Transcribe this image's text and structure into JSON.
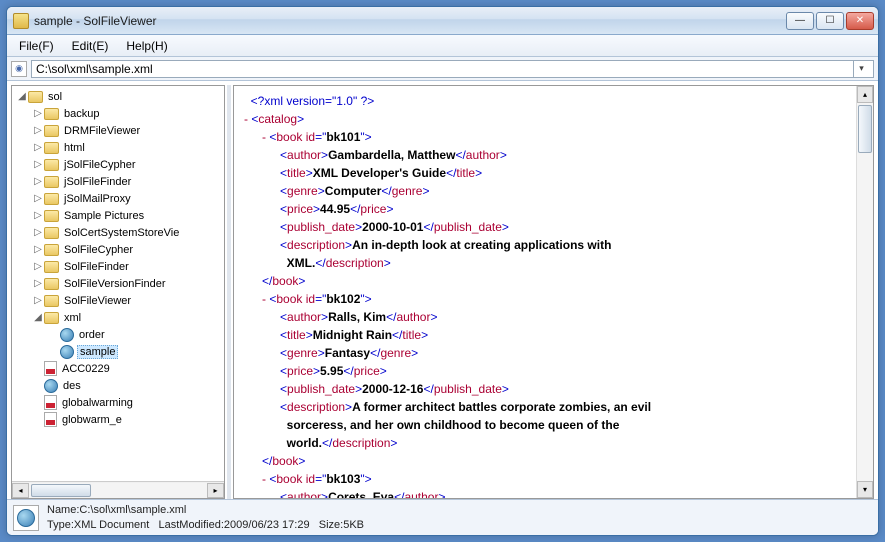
{
  "window": {
    "title": "sample - SolFileViewer"
  },
  "menu": {
    "file": "File(F)",
    "edit": "Edit(E)",
    "help": "Help(H)"
  },
  "address": {
    "path": "C:\\sol\\xml\\sample.xml"
  },
  "tree": {
    "root": "sol",
    "folders": [
      "backup",
      "DRMFileViewer",
      "html",
      "jSolFileCypher",
      "jSolFileFinder",
      "jSolMailProxy",
      "Sample Pictures",
      "SolCertSystemStoreVie",
      "SolFileCypher",
      "SolFileFinder",
      "SolFileVersionFinder",
      "SolFileViewer"
    ],
    "xml_folder": "xml",
    "xml_children": [
      {
        "name": "order",
        "type": "earth"
      },
      {
        "name": "sample",
        "type": "earth",
        "selected": true
      }
    ],
    "other_children": [
      {
        "name": "ACC0229",
        "type": "pdf"
      },
      {
        "name": "des",
        "type": "earth"
      },
      {
        "name": "globalwarming",
        "type": "pdf"
      },
      {
        "name": "globwarm_e",
        "type": "pdf"
      }
    ]
  },
  "xml": {
    "decl": "<?xml version=\"1.0\" ?>",
    "root_tag": "catalog",
    "books": [
      {
        "id": "bk101",
        "author": "Gambardella, Matthew",
        "title": "XML Developer's Guide",
        "genre": "Computer",
        "price": "44.95",
        "publish_date": "2000-10-01",
        "description_l1": "An in-depth look at creating applications with",
        "description_l2": "XML."
      },
      {
        "id": "bk102",
        "author": "Ralls, Kim",
        "title": "Midnight Rain",
        "genre": "Fantasy",
        "price": "5.95",
        "publish_date": "2000-12-16",
        "description_l1": "A former architect battles corporate zombies, an evil",
        "description_l2": "sorceress, and her own childhood to become queen of the",
        "description_l3": "world."
      },
      {
        "id": "bk103",
        "author_partial": "Corets  Eva"
      }
    ]
  },
  "status": {
    "line1_label": "Name:",
    "line1_value": "C:\\sol\\xml\\sample.xml",
    "line2_type_label": "Type:",
    "line2_type_value": "XML Document",
    "line2_mod_label": "LastModified:",
    "line2_mod_value": "2009/06/23 17:29",
    "line2_size_label": "Size:",
    "line2_size_value": "5KB"
  }
}
